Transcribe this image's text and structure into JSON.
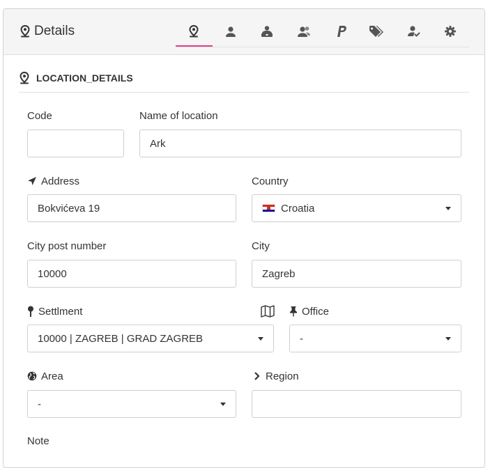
{
  "header": {
    "title": "Details",
    "tabs": [
      {
        "icon": "map-marker-icon",
        "active": true
      },
      {
        "icon": "user-icon",
        "active": false
      },
      {
        "icon": "user-tie-icon",
        "active": false
      },
      {
        "icon": "users-icon",
        "active": false
      },
      {
        "icon": "paypal-icon",
        "active": false
      },
      {
        "icon": "tags-icon",
        "active": false
      },
      {
        "icon": "user-check-icon",
        "active": false
      },
      {
        "icon": "gear-icon",
        "active": false
      }
    ]
  },
  "section": {
    "title": "LOCATION_DETAILS"
  },
  "form": {
    "code": {
      "label": "Code",
      "value": ""
    },
    "name": {
      "label": "Name of location",
      "value": "Ark"
    },
    "address": {
      "label": "Address",
      "value": "Bokvićeva 19",
      "icon": "location-arrow-icon"
    },
    "country": {
      "label": "Country",
      "value": "Croatia",
      "flag_colors": [
        "#d52b1e",
        "#ffffff",
        "#171796"
      ]
    },
    "post_number": {
      "label": "City post number",
      "value": "10000"
    },
    "city": {
      "label": "City",
      "value": "Zagreb"
    },
    "settlement": {
      "label": "Settlment",
      "value": "10000 | ZAGREB | GRAD ZAGREB",
      "icon": "map-pin-icon"
    },
    "map_button": {
      "icon": "map-icon"
    },
    "office": {
      "label": "Office",
      "value": "-",
      "icon": "thumbtack-icon"
    },
    "area": {
      "label": "Area",
      "value": "-",
      "icon": "globe-icon"
    },
    "region": {
      "label": "Region",
      "value": "",
      "icon": "chevron-right-icon"
    },
    "note": {
      "label": "Note"
    }
  },
  "colors": {
    "accent": "#e0408a",
    "text": "#333333",
    "border": "#cfcfcf",
    "header_bg": "#f5f5f5"
  }
}
